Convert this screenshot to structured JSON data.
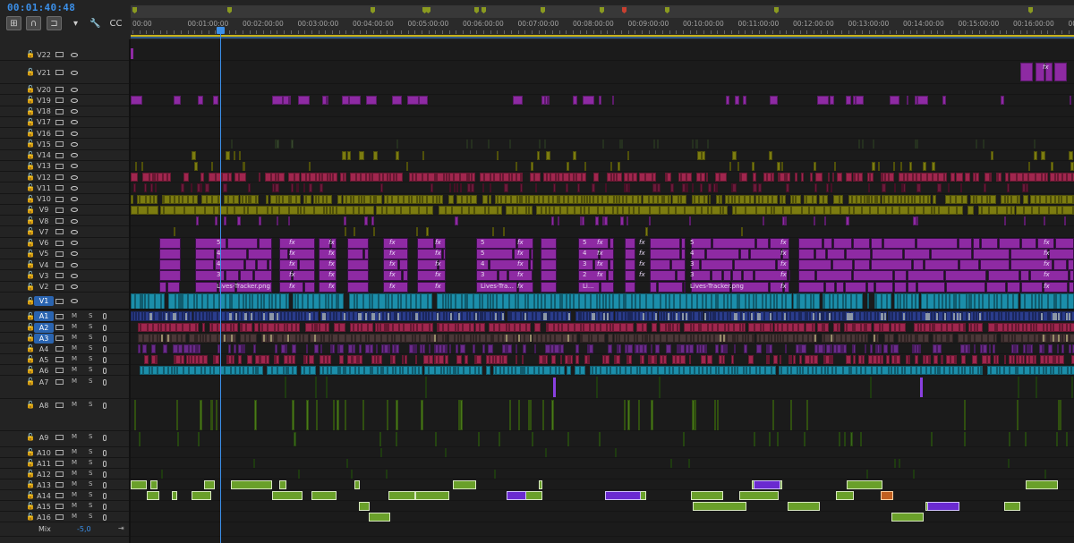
{
  "timecode": "00:01:40:48",
  "ruler": {
    "labels": [
      "00:00",
      "00:01:00:00",
      "00:02:00:00",
      "00:03:00:00",
      "00:04:00:00",
      "00:05:00:00",
      "00:06:00:00",
      "00:07:00:00",
      "00:08:00:00",
      "00:09:00:00",
      "00:10:00:00",
      "00:11:00:00",
      "00:12:00:00",
      "00:13:00:00",
      "00:14:00:00",
      "00:15:00:00",
      "00:16:00:00",
      "00:17:0"
    ]
  },
  "toolbar": [
    {
      "name": "insert-sequence-nest-icon",
      "glyph": "⊞"
    },
    {
      "name": "snap-magnet-icon",
      "glyph": "∩"
    },
    {
      "name": "linked-selection-icon",
      "glyph": "⊐"
    },
    {
      "name": "add-marker-icon",
      "glyph": "▾"
    },
    {
      "name": "timeline-settings-wrench-icon",
      "glyph": "🔧"
    },
    {
      "name": "captions-icon",
      "glyph": "CC"
    }
  ],
  "video_tracks": [
    "V22",
    "V21",
    "V20",
    "V19",
    "V18",
    "V17",
    "V16",
    "V15",
    "V14",
    "V13",
    "V12",
    "V11",
    "V10",
    "V9",
    "V8",
    "V7",
    "V6",
    "V5",
    "V4",
    "V3",
    "V2",
    "V1"
  ],
  "audio_tracks": [
    "A1",
    "A2",
    "A3",
    "A4",
    "A5",
    "A6",
    "A7",
    "A8",
    "A9",
    "A10",
    "A11",
    "A12",
    "A13",
    "A14",
    "A15",
    "A16"
  ],
  "audio_buttons": {
    "mute": "M",
    "solo": "S"
  },
  "mix": {
    "label": "Mix",
    "value": "-5,0"
  },
  "clip_labels": {
    "lives_tracker": "Lives-Tracker.png",
    "lives_tracker_short": "Lives-Tra...",
    "lives_tracker_tiny": "Li...",
    "fx": "fx",
    "numbers_a": [
      "5",
      "5",
      "5",
      "5",
      "5"
    ],
    "numbers_b": [
      "4",
      "5",
      "4",
      "4",
      "4"
    ],
    "numbers_c": [
      "4",
      "4",
      "3",
      "3",
      "4"
    ],
    "numbers_d": [
      "3",
      "3",
      "2",
      "3",
      "3"
    ]
  },
  "colors": {
    "accent": "#3b8fe8",
    "purple": "#8e2aa3",
    "magenta": "#a0264e",
    "olive": "#7c7c10",
    "teal": "#1b8eaa",
    "navy": "#2a3c8c",
    "green": "#6aa02a",
    "violet": "#6a2ad0"
  }
}
